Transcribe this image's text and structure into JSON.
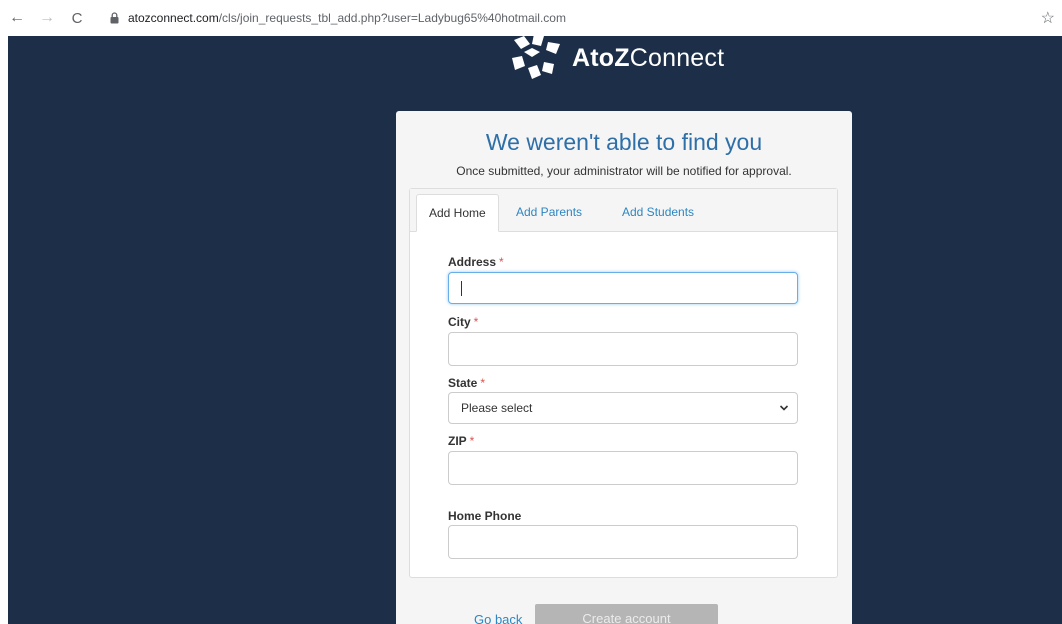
{
  "browser": {
    "url_host": "atozconnect.com",
    "url_path": "/cls/join_requests_tbl_add.php?user=Ladybug65%40hotmail.com",
    "back_icon": "←",
    "forward_icon": "→",
    "reload_icon": "C",
    "star_icon": "☆"
  },
  "brand": {
    "name_bold": "AtoZ",
    "name_regular": "Connect"
  },
  "form": {
    "title": "We weren't able to find you",
    "subtitle": "Once submitted, your administrator will be notified for approval.",
    "tabs": [
      "Add Home",
      "Add Parents",
      "Add Students"
    ],
    "active_tab": "Add Home",
    "fields": {
      "address": {
        "label": "Address",
        "required_mark": "*",
        "value": ""
      },
      "city": {
        "label": "City",
        "required_mark": "*",
        "value": ""
      },
      "state": {
        "label": "State",
        "required_mark": "*",
        "selected": "Please select"
      },
      "zip": {
        "label": "ZIP",
        "required_mark": "*",
        "value": ""
      },
      "home_phone": {
        "label": "Home Phone",
        "value": ""
      }
    },
    "go_back_label": "Go back",
    "create_label": "Create account"
  },
  "colors": {
    "page_background": "#1d2f48",
    "title": "#2e6fa8",
    "link": "#2e86c1",
    "required": "#d9534f",
    "disabled_button": "#b5b5b5"
  }
}
